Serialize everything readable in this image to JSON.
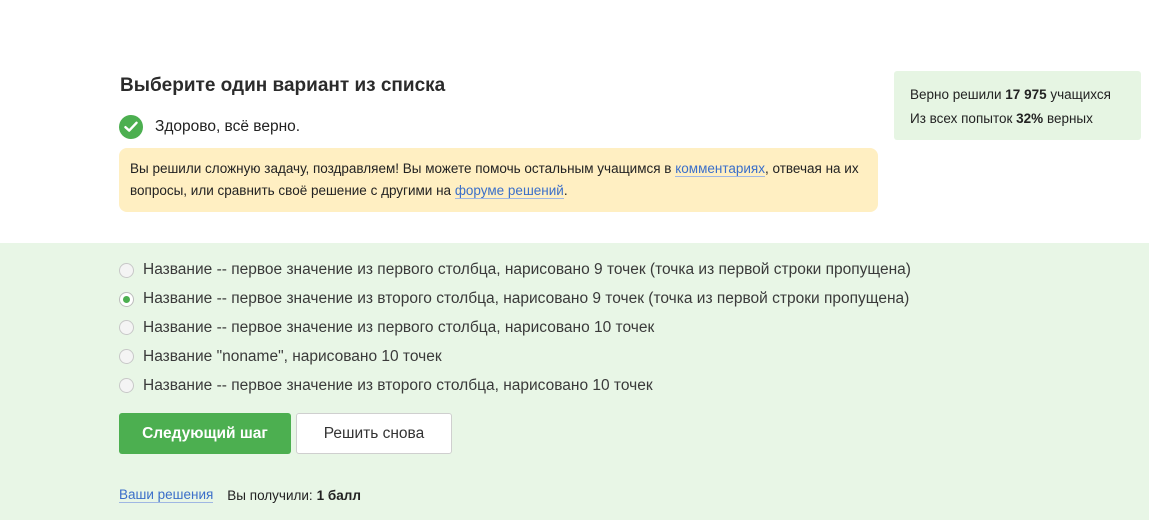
{
  "question": {
    "title": "Выберите один вариант из списка"
  },
  "status": {
    "text": "Здорово, всё верно."
  },
  "notice": {
    "text_before": "Вы решили сложную задачу, поздравляем! Вы можете помочь остальным учащимся в ",
    "comments_link": "комментариях",
    "text_middle": ", отвечая на их вопросы, или сравнить своё решение с другими на ",
    "forum_link": "форуме решений",
    "text_after": "."
  },
  "stats": {
    "solved_prefix": "Верно решили ",
    "solved_count": "17 975",
    "solved_suffix": " учащихся",
    "attempts_prefix": "Из всех попыток ",
    "attempts_percent": "32%",
    "attempts_suffix": " верных"
  },
  "options": [
    {
      "label": "Название -- первое значение из первого столбца, нарисовано 9 точек (точка из первой строки пропущена)",
      "selected": false
    },
    {
      "label": "Название -- первое значение из второго столбца, нарисовано 9 точек (точка из первой строки пропущена)",
      "selected": true
    },
    {
      "label": "Название -- первое значение из первого столбца, нарисовано 10 точек",
      "selected": false
    },
    {
      "label": "Название \"noname\", нарисовано 10 точек",
      "selected": false
    },
    {
      "label": "Название -- первое значение из второго столбца, нарисовано 10 точек",
      "selected": false
    }
  ],
  "buttons": {
    "next": "Следующий шаг",
    "retry": "Решить снова"
  },
  "footer": {
    "solutions_link": "Ваши решения",
    "got_text": "Вы получили:",
    "score": "1 балл"
  },
  "colors": {
    "accent_green": "#4caf50",
    "answer_bg": "#e8f6e6",
    "notice_bg": "#ffefc2",
    "link": "#3b6fc9"
  },
  "icons": {
    "status": "check-circle-icon",
    "radio": "radio-icon"
  }
}
